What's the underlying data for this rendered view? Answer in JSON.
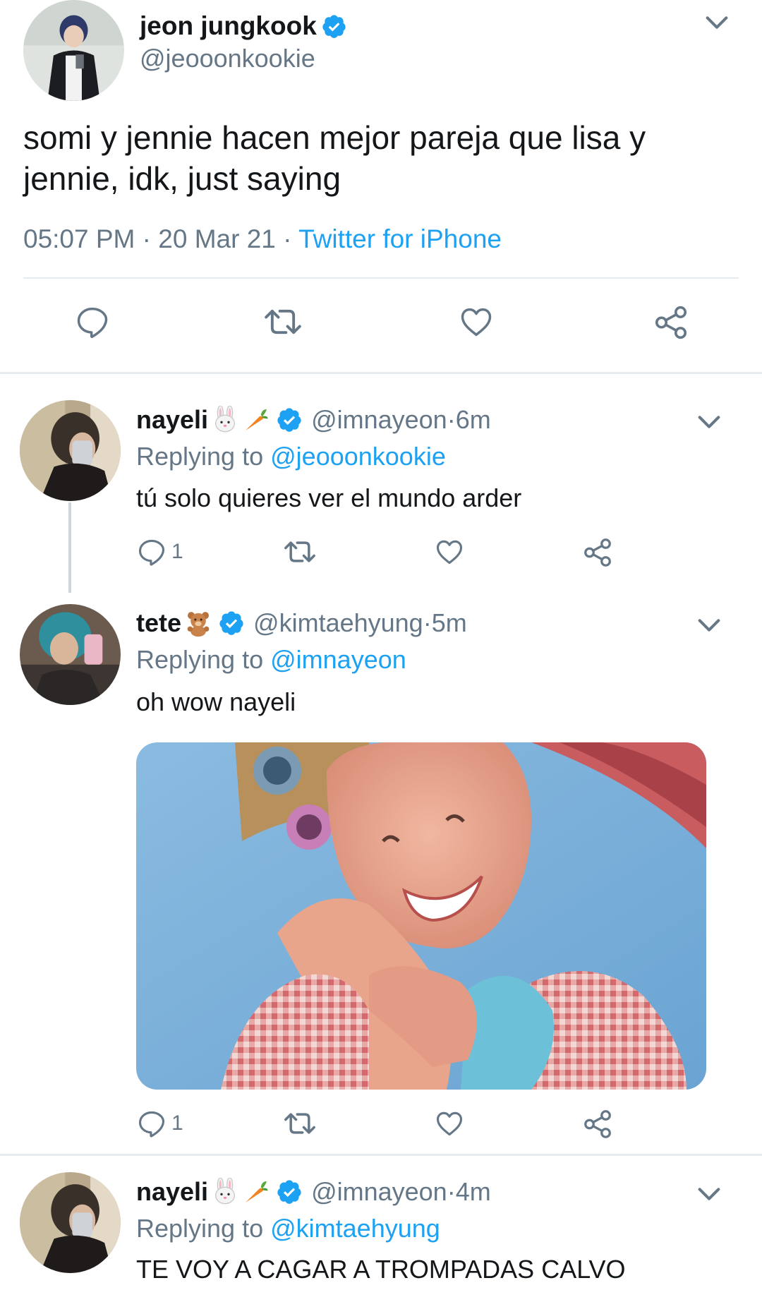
{
  "main_tweet": {
    "name": "jeon jungkook",
    "handle": "@jeooonkookie",
    "text": "somi y jennie hacen mejor pareja que lisa y jennie, idk, just saying",
    "time": "05:07 PM",
    "date": "20 Mar 21",
    "source": "Twitter for iPhone",
    "separator": " · "
  },
  "replies": [
    {
      "name": "nayeli",
      "emojis": [
        "rabbit-face",
        "carrot"
      ],
      "handle": "@imnayeon",
      "age": "6m",
      "replying_label": "Replying to",
      "replying_to": "@jeooonkookie",
      "text": "tú solo quieres ver el mundo arder",
      "reply_count": "1"
    },
    {
      "name": "tete",
      "emojis": [
        "teddy-bear"
      ],
      "handle": "@kimtaehyung",
      "age": "5m",
      "replying_label": "Replying to",
      "replying_to": "@imnayeon",
      "text": "oh wow nayeli",
      "reply_count": "1",
      "media": "photo of a smiling woman with hair curlers"
    },
    {
      "name": "nayeli",
      "emojis": [
        "rabbit-face",
        "carrot"
      ],
      "handle": "@imnayeon",
      "age": "4m",
      "replying_label": "Replying to",
      "replying_to": "@kimtaehyung",
      "text": "TE VOY A CAGAR A TROMPADAS CALVO"
    }
  ],
  "colors": {
    "link": "#1da1f2",
    "secondary": "#657786",
    "primary_text": "#14171a",
    "divider": "#e6ecf0"
  },
  "icons": {
    "reply": "reply-icon",
    "retweet": "retweet-icon",
    "like": "like-icon",
    "share": "share-icon",
    "verified": "verified-badge-icon",
    "menu": "chevron-down-icon"
  }
}
